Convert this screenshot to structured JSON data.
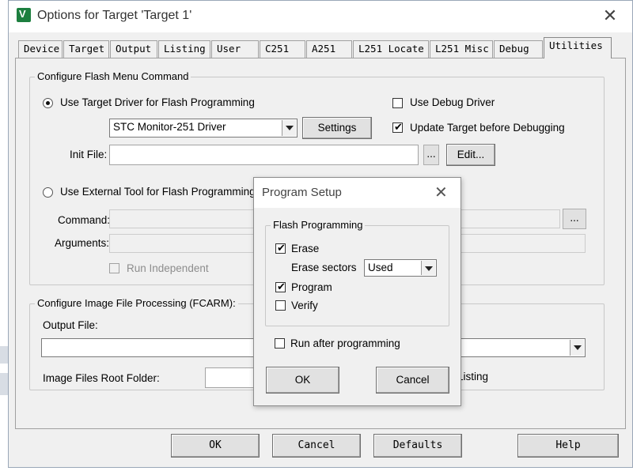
{
  "window": {
    "title": "Options for Target 'Target 1'",
    "close_glyph": "✕"
  },
  "tabs": [
    {
      "label": "Device"
    },
    {
      "label": "Target"
    },
    {
      "label": "Output"
    },
    {
      "label": "Listing"
    },
    {
      "label": "User"
    },
    {
      "label": "C251"
    },
    {
      "label": "A251"
    },
    {
      "label": "L251 Locate"
    },
    {
      "label": "L251 Misc"
    },
    {
      "label": "Debug"
    },
    {
      "label": "Utilities",
      "active": true
    }
  ],
  "flash": {
    "group_label": "Configure Flash Menu Command",
    "use_target_driver_label": "Use Target Driver for Flash Programming",
    "driver_selected": "STC Monitor-251 Driver",
    "settings_label": "Settings",
    "use_debug_driver_label": "Use Debug Driver",
    "update_target_label": "Update Target before Debugging",
    "init_file_label": "Init File:",
    "init_file_value": "",
    "browse_label": "...",
    "edit_label": "Edit...",
    "use_external_tool_label": "Use External Tool for Flash Programming",
    "command_label": "Command:",
    "arguments_label": "Arguments:",
    "run_independent_label": "Run Independent",
    "command_browse_label": "..."
  },
  "image": {
    "group_label": "Configure Image File Processing (FCARM):",
    "output_file_label": "Output File:",
    "root_folder_label": "Image Files Root Folder:",
    "listing_partial": "Listing"
  },
  "footer": {
    "ok": "OK",
    "cancel": "Cancel",
    "defaults": "Defaults",
    "help": "Help"
  },
  "popup": {
    "title": "Program Setup",
    "close_glyph": "✕",
    "group_label": "Flash Programming",
    "erase_label": "Erase",
    "erase_sectors_label": "Erase sectors",
    "erase_sectors_value": "Used",
    "program_label": "Program",
    "verify_label": "Verify",
    "run_after_label": "Run after programming",
    "ok": "OK",
    "cancel": "Cancel"
  },
  "colors": {
    "window_bg": "#f0f0f0",
    "app_icon": "#1d7f3f"
  }
}
